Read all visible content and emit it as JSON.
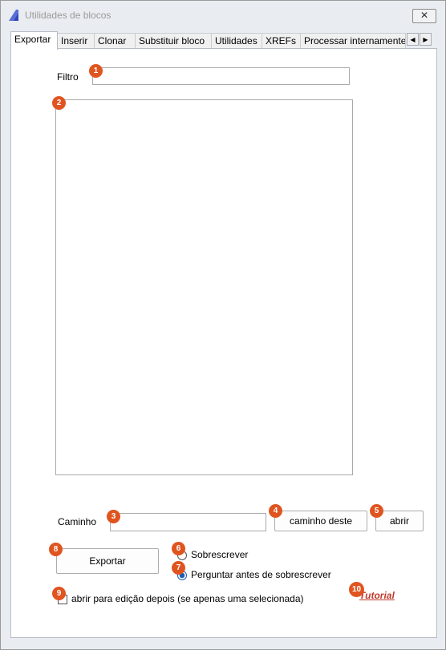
{
  "window": {
    "title": "Utilidades de blocos",
    "close_symbol": "✕"
  },
  "tabs": [
    {
      "label": "Exportar"
    },
    {
      "label": "Inserir"
    },
    {
      "label": "Clonar"
    },
    {
      "label": "Substituir bloco"
    },
    {
      "label": "Utilidades"
    },
    {
      "label": "XREFs"
    },
    {
      "label": "Processar internamente"
    }
  ],
  "tab_scroll": {
    "left": "◀",
    "right": "▶"
  },
  "export": {
    "filter_label": "Filtro",
    "filter_value": "",
    "path_label": "Caminho",
    "path_value": "",
    "this_path_button": "caminho deste",
    "open_button": "abrir",
    "export_button": "Exportar",
    "overwrite_label": "Sobrescrever",
    "ask_overwrite_label": "Perguntar antes de sobrescrever",
    "ask_overwrite_selected": true,
    "open_edit_label": "abrir para edição depois (se apenas uma selecionada)",
    "open_edit_checked": false,
    "tutorial_link": "Tutorial"
  },
  "badges": [
    "1",
    "2",
    "3",
    "4",
    "5",
    "6",
    "7",
    "8",
    "9",
    "10"
  ],
  "colors": {
    "badge": "#e0541f",
    "link": "#c0392b",
    "radio_selected": "#1a5fb4"
  }
}
